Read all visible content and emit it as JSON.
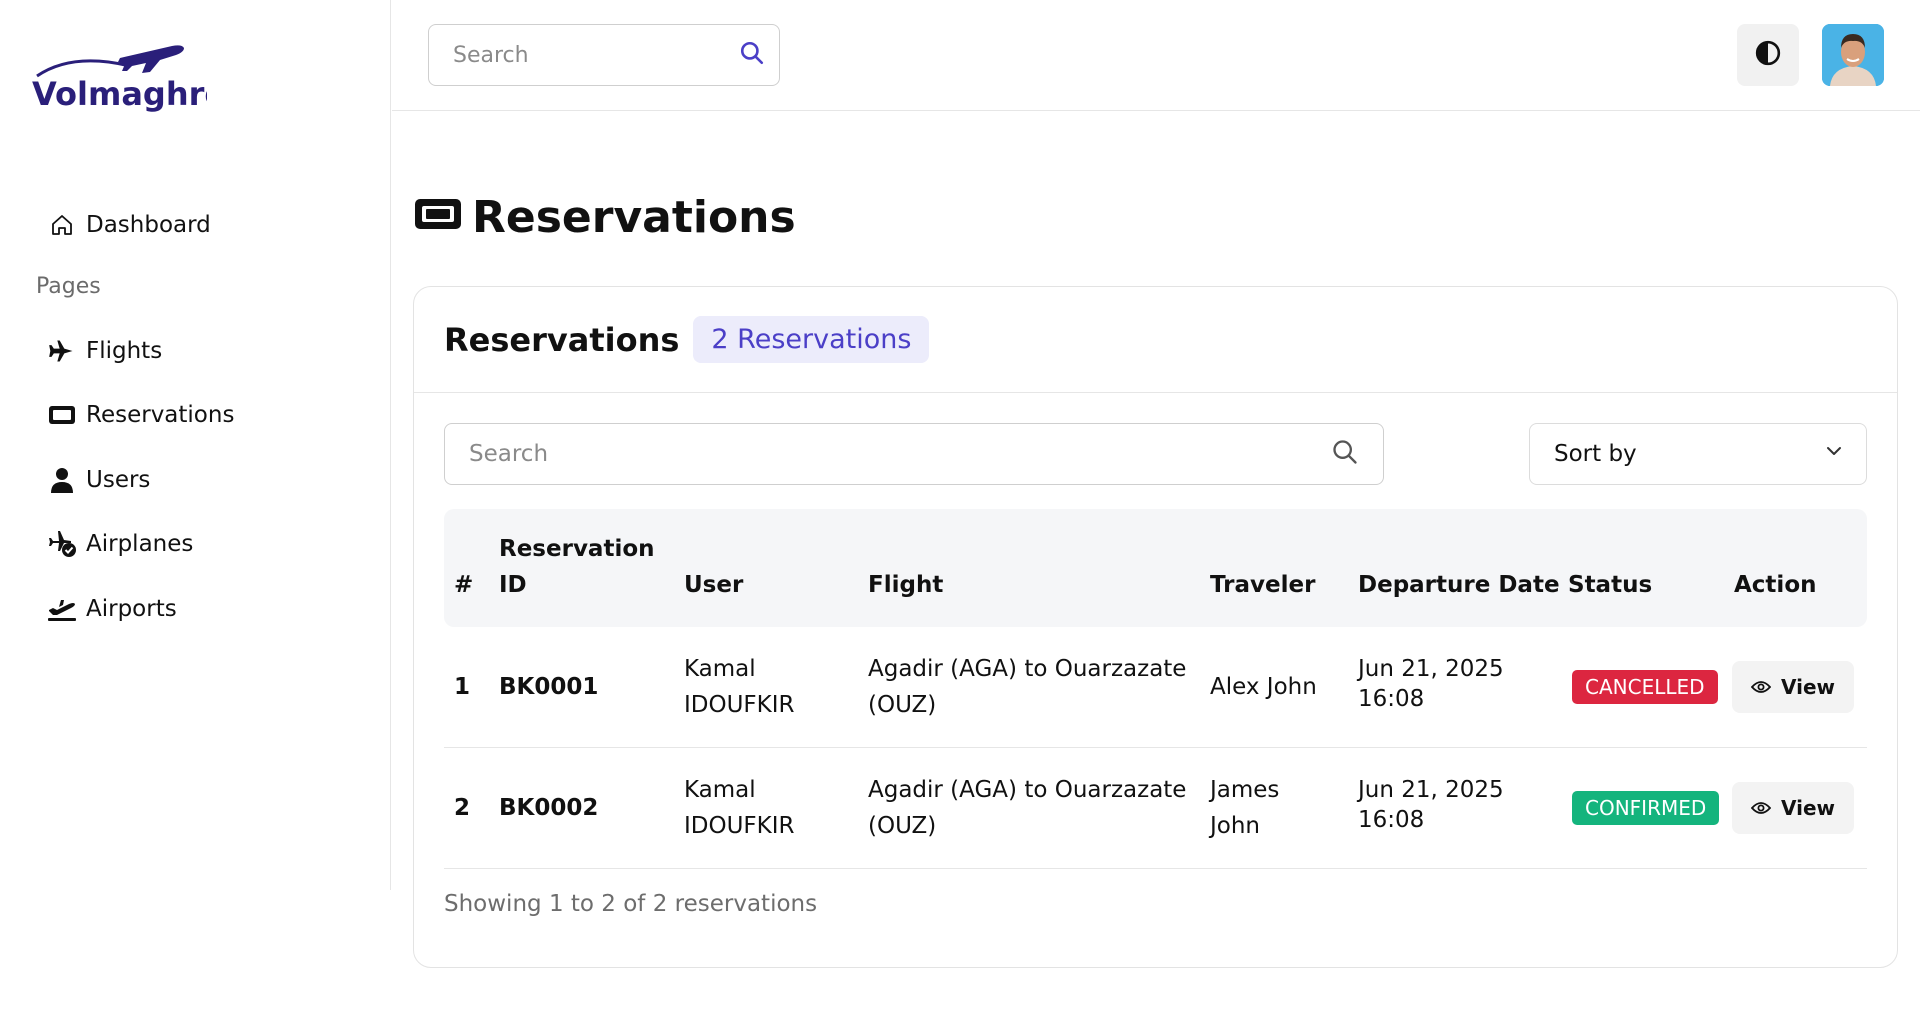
{
  "brand": {
    "name": "Volmaghreb",
    "color": "#2a1f7a"
  },
  "topbar": {
    "search_placeholder": "Search",
    "theme_icon": "contrast-icon",
    "avatar_icon": "user-avatar"
  },
  "sidebar": {
    "dashboard": "Dashboard",
    "section_label": "Pages",
    "items": [
      {
        "label": "Flights",
        "icon": "plane-icon"
      },
      {
        "label": "Reservations",
        "icon": "ticket-icon"
      },
      {
        "label": "Users",
        "icon": "user-icon"
      },
      {
        "label": "Airplanes",
        "icon": "plane-check-icon"
      },
      {
        "label": "Airports",
        "icon": "plane-departure-icon"
      }
    ]
  },
  "page": {
    "title": "Reservations"
  },
  "card": {
    "title": "Reservations",
    "count_badge": "2 Reservations",
    "search_placeholder": "Search",
    "sort_label": "Sort by",
    "footer": "Showing 1 to 2 of 2 reservations"
  },
  "table": {
    "headers": {
      "num": "#",
      "reservation_id": "Reservation ID",
      "user": "User",
      "flight": "Flight",
      "traveler": "Traveler",
      "departure": "Departure Date",
      "status": "Status",
      "action": "Action"
    },
    "rows": [
      {
        "num": "1",
        "id": "BK0001",
        "user": "Kamal IDOUFKIR",
        "flight": "Agadir (AGA) to Ouarzazate (OUZ)",
        "traveler": "Alex John",
        "departure_date": "Jun 21, 2025",
        "departure_time": "16:08",
        "status": "CANCELLED",
        "action": "View"
      },
      {
        "num": "2",
        "id": "BK0002",
        "user": "Kamal IDOUFKIR",
        "flight": "Agadir (AGA) to Ouarzazate (OUZ)",
        "traveler": "James John",
        "departure_date": "Jun 21, 2025",
        "departure_time": "16:08",
        "status": "CONFIRMED",
        "action": "View"
      }
    ]
  },
  "colors": {
    "accent": "#4b3fc7",
    "badge_bg": "#ececfb",
    "cancelled": "#dc2640",
    "confirmed": "#14b47d"
  }
}
